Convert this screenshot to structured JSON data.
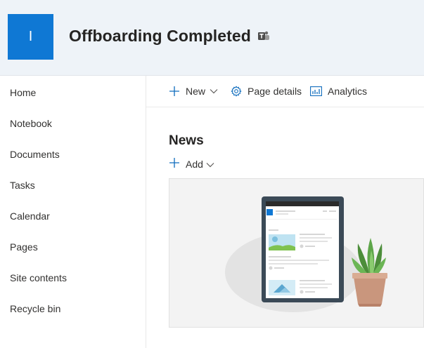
{
  "header": {
    "logo_letter": "I",
    "site_title": "Offboarding Completed",
    "logo_color": "#0f78d4",
    "teams_icon": "teams-icon"
  },
  "nav": {
    "items": [
      {
        "label": "Home"
      },
      {
        "label": "Notebook"
      },
      {
        "label": "Documents"
      },
      {
        "label": "Tasks"
      },
      {
        "label": "Calendar"
      },
      {
        "label": "Pages"
      },
      {
        "label": "Site contents"
      },
      {
        "label": "Recycle bin"
      }
    ]
  },
  "commandbar": {
    "new_label": "New",
    "page_details_label": "Page details",
    "analytics_label": "Analytics"
  },
  "news": {
    "title": "News",
    "add_label": "Add"
  }
}
